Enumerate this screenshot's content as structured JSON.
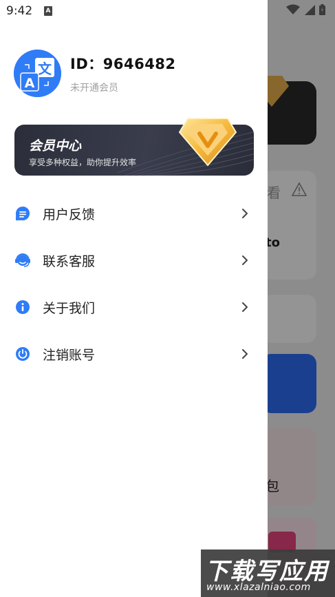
{
  "status_bar": {
    "time": "9:42",
    "notif_badge": "A",
    "icons": [
      "wifi-icon",
      "signal-icon",
      "battery-icon"
    ]
  },
  "profile": {
    "id_text": "ID：9646482",
    "membership_status": "未开通会员",
    "avatar_glyph_top": "文",
    "avatar_glyph_bottom": "A"
  },
  "member_card": {
    "title": "会员中心",
    "subtitle": "享受多种权益，助你提升效率"
  },
  "menu": {
    "items": [
      {
        "label": "用户反馈",
        "icon": "feedback-icon"
      },
      {
        "label": "联系客服",
        "icon": "customer-service-icon"
      },
      {
        "label": "关于我们",
        "icon": "info-icon"
      },
      {
        "label": "注销账号",
        "icon": "logout-icon"
      }
    ]
  },
  "background": {
    "text_a": "看",
    "text_b": "to",
    "text_c": "包"
  },
  "watermark": {
    "title": "下载写应用",
    "url": "www.xlazalniao.com"
  },
  "colors": {
    "accent": "#2f7cf6",
    "card_dark": "#2b2e3a",
    "gold": "#f5b93a"
  }
}
